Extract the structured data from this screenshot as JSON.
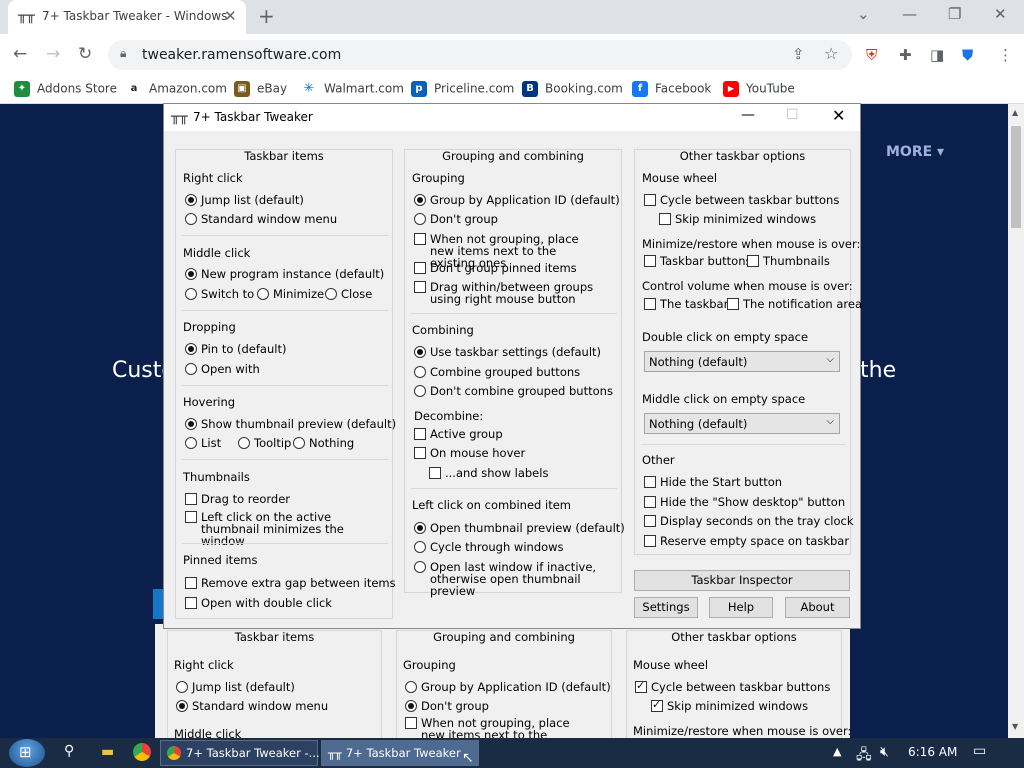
{
  "browser": {
    "tab_title": "7+ Taskbar Tweaker - Windows",
    "tab_close": "✕",
    "new_tab": "+",
    "window_controls": [
      "⌄",
      "—",
      "❐",
      "✕"
    ],
    "url": "tweaker.ramensoftware.com",
    "bookmarks": [
      {
        "label": "Addons Store",
        "icon": "addons-icon",
        "color": "#1e8e3e",
        "glyph": "✦"
      },
      {
        "label": "Amazon.com",
        "icon": "amazon-icon",
        "color": "#222222",
        "glyph": "a"
      },
      {
        "label": "eBay",
        "icon": "ebay-icon",
        "color": "#7a5b1c",
        "glyph": "▣"
      },
      {
        "label": "Walmart.com",
        "icon": "walmart-icon",
        "color": "#0a6ed1",
        "glyph": "✳"
      },
      {
        "label": "Priceline.com",
        "icon": "priceline-icon",
        "color": "#0b61b8",
        "glyph": "p"
      },
      {
        "label": "Booking.com",
        "icon": "booking-icon",
        "color": "#003580",
        "glyph": "B"
      },
      {
        "label": "Facebook",
        "icon": "facebook-icon",
        "color": "#1877f2",
        "glyph": "f"
      },
      {
        "label": "YouTube",
        "icon": "youtube-icon",
        "color": "#ff0000",
        "glyph": "▶"
      }
    ]
  },
  "page": {
    "more": "MORE ▾",
    "headline_left": "Custo",
    "headline_right": "the"
  },
  "dialog": {
    "title": "7+ Taskbar Tweaker",
    "col1": {
      "title": "Taskbar items",
      "right_click": {
        "label": "Right click",
        "opts": [
          "Jump list (default)",
          "Standard window menu"
        ]
      },
      "middle_click": {
        "label": "Middle click",
        "opts": [
          "New program instance (default)",
          "Switch to",
          "Minimize",
          "Close"
        ]
      },
      "dropping": {
        "label": "Dropping",
        "opts": [
          "Pin to (default)",
          "Open with"
        ]
      },
      "hovering": {
        "label": "Hovering",
        "opts": [
          "Show thumbnail preview (default)",
          "List",
          "Tooltip",
          "Nothing"
        ]
      },
      "thumbnails": {
        "label": "Thumbnails",
        "opts": [
          "Drag to reorder",
          "Left click on the active thumbnail minimizes the window"
        ]
      },
      "pinned": {
        "label": "Pinned items",
        "opts": [
          "Remove extra gap between items",
          "Open with double click"
        ]
      }
    },
    "col2": {
      "title": "Grouping and combining",
      "grouping": {
        "label": "Grouping",
        "opts": [
          "Group by Application ID (default)",
          "Don't group",
          "When not grouping, place new items next to the existing ones",
          "Don't group pinned items",
          "Drag within/between groups using right mouse button"
        ]
      },
      "combining": {
        "label": "Combining",
        "opts": [
          "Use taskbar settings (default)",
          "Combine grouped buttons",
          "Don't combine grouped buttons"
        ]
      },
      "decombine": {
        "label": "Decombine:",
        "opts": [
          "Active group",
          "On mouse hover",
          "...and show labels"
        ]
      },
      "left_click": {
        "label": "Left click on combined item",
        "opts": [
          "Open thumbnail preview (default)",
          "Cycle through windows",
          "Open last window if inactive, otherwise open thumbnail preview"
        ]
      }
    },
    "col3": {
      "title": "Other taskbar options",
      "mouse_wheel": {
        "label": "Mouse wheel",
        "opts": [
          "Cycle between taskbar buttons",
          "Skip minimized windows"
        ]
      },
      "minimize": {
        "label": "Minimize/restore when mouse is over:",
        "opts": [
          "Taskbar buttons",
          "Thumbnails"
        ]
      },
      "volume": {
        "label": "Control volume when mouse is over:",
        "opts": [
          "The taskbar",
          "The notification area"
        ]
      },
      "double_click": {
        "label": "Double click on empty space",
        "value": "Nothing (default)"
      },
      "middle_click": {
        "label": "Middle click on empty space",
        "value": "Nothing (default)"
      },
      "other": {
        "label": "Other",
        "opts": [
          "Hide the Start button",
          "Hide the \"Show desktop\" button",
          "Display seconds on the tray clock",
          "Reserve empty space on taskbar"
        ]
      }
    },
    "buttons": {
      "inspector": "Taskbar Inspector",
      "settings": "Settings",
      "help": "Help",
      "about": "About"
    }
  },
  "ghost": {
    "col1_title": "Taskbar items",
    "col2_title": "Grouping and combining",
    "col3_title": "Other taskbar options",
    "right_click": "Right click",
    "rc_opts": [
      "Jump list (default)",
      "Standard window menu"
    ],
    "middle_click": "Middle click",
    "grouping": "Grouping",
    "g_opts": [
      "Group by Application ID (default)",
      "Don't group",
      "When not grouping, place new items next to the existing ones"
    ],
    "mouse_wheel": "Mouse wheel",
    "mw_opts": [
      "Cycle between taskbar buttons",
      "Skip minimized windows"
    ],
    "minimize": "Minimize/restore when mouse is over:"
  },
  "taskbar": {
    "buttons": [
      "7+ Taskbar Tweaker -...",
      "7+ Taskbar Tweaker"
    ],
    "time": "6:16 AM"
  }
}
